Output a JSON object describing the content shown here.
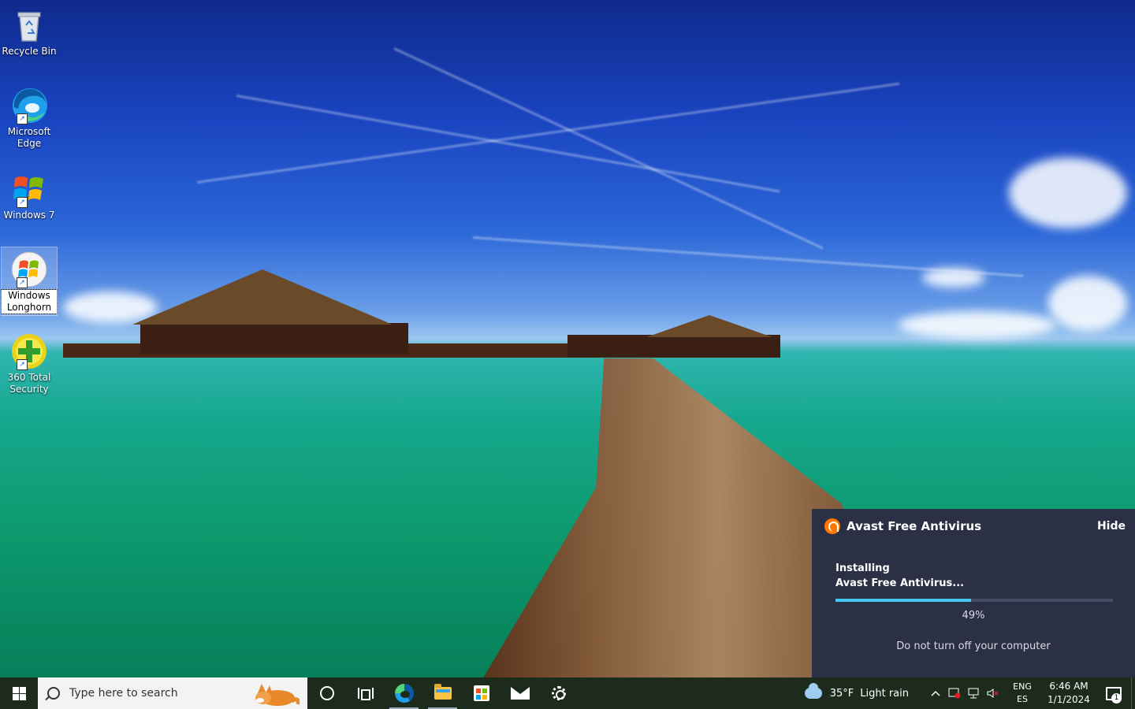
{
  "desktop": {
    "icons": [
      {
        "label": "Recycle Bin"
      },
      {
        "label": "Microsoft Edge"
      },
      {
        "label": "Windows 7"
      },
      {
        "label": "Windows Longhorn"
      },
      {
        "label": "360 Total Security"
      }
    ]
  },
  "avast": {
    "title": "Avast Free Antivirus",
    "hide_label": "Hide",
    "status_line1": "Installing",
    "status_line2": "Avast Free Antivirus...",
    "progress_text": "49%",
    "progress_value": 0.49,
    "note": "Do not turn off your computer",
    "accent": "#ff7800",
    "bar_color": "#46c6f0"
  },
  "taskbar": {
    "search_placeholder": "Type here to search",
    "weather_temp": "35°F",
    "weather_desc": "Light rain",
    "lang_line1": "ENG",
    "lang_line2": "ES",
    "time": "6:46 AM",
    "date": "1/1/2024",
    "notification_count": "1",
    "tray_overflow_glyph": "^",
    "pinned": [
      "cortana-icon",
      "task-view-icon",
      "edge-icon",
      "file-explorer-icon",
      "store-icon",
      "mail-icon",
      "settings-icon"
    ]
  }
}
